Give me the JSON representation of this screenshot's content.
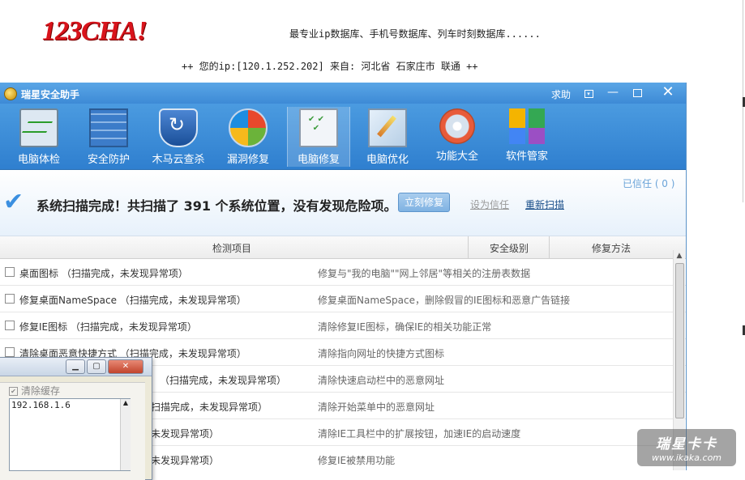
{
  "website": {
    "logo_text": "123CHA!",
    "slogan": "最专业ip数据库、手机号数据库、列车时刻数据库......",
    "ip_line": "++ 您的ip:[120.1.252.202] 来自: 河北省 石家庄市 联通 ++"
  },
  "app": {
    "title": "瑞星安全助手",
    "help_label": "求助",
    "toolbar": [
      {
        "label": "电脑体检",
        "icon": "monitor-icon"
      },
      {
        "label": "安全防护",
        "icon": "firewall-icon"
      },
      {
        "label": "木马云查杀",
        "icon": "shield-icon"
      },
      {
        "label": "漏洞修复",
        "icon": "windows-icon"
      },
      {
        "label": "电脑修复",
        "icon": "clipboard-check-icon",
        "active": true
      },
      {
        "label": "电脑优化",
        "icon": "optimize-icon"
      },
      {
        "label": "功能大全",
        "icon": "disc-icon"
      },
      {
        "label": "软件管家",
        "icon": "software-boxes-icon"
      }
    ],
    "status": {
      "message": "系统扫描完成！共扫描了 391 个系统位置，没有发现危险项。",
      "fix_button": "立刻修复",
      "trust_link": "设为信任",
      "rescan_link": "重新扫描",
      "trusted_count": "已信任 ( 0 )"
    },
    "table": {
      "columns": [
        "检测项目",
        "安全级别",
        "修复方法"
      ],
      "rows": [
        {
          "name": "桌面图标 （扫描完成，未发现异常项）",
          "method": "修复与\"我的电脑\"\"网上邻居\"等相关的注册表数据"
        },
        {
          "name": "修复桌面NameSpace （扫描完成，未发现异常项）",
          "method": "修复桌面NameSpace，删除假冒的IE图标和恶意广告链接"
        },
        {
          "name": "修复IE图标 （扫描完成，未发现异常项）",
          "method": "清除修复IE图标，确保IE的相关功能正常"
        },
        {
          "name": "清除桌面恶意快捷方式 （扫描完成，未发现异常项）",
          "method": "清除指向网址的快捷方式图标"
        },
        {
          "name": "（扫描完成，未发现异常项）",
          "method": "清除快速启动栏中的恶意网址"
        },
        {
          "name": "扫描完成，未发现异常项）",
          "method": "清除开始菜单中的恶意网址"
        },
        {
          "name": "未发现异常项）",
          "method": "清除IE工具栏中的扩展按钮，加速IE的启动速度"
        },
        {
          "name": "未发现异常项）",
          "method": "修复IE被禁用功能"
        }
      ]
    }
  },
  "dialog": {
    "checkbox_label": "清除缓存",
    "textarea_value": "192.168.1.6"
  },
  "watermark": {
    "main": "瑞星卡卡",
    "url": "www.ikaka.com"
  }
}
